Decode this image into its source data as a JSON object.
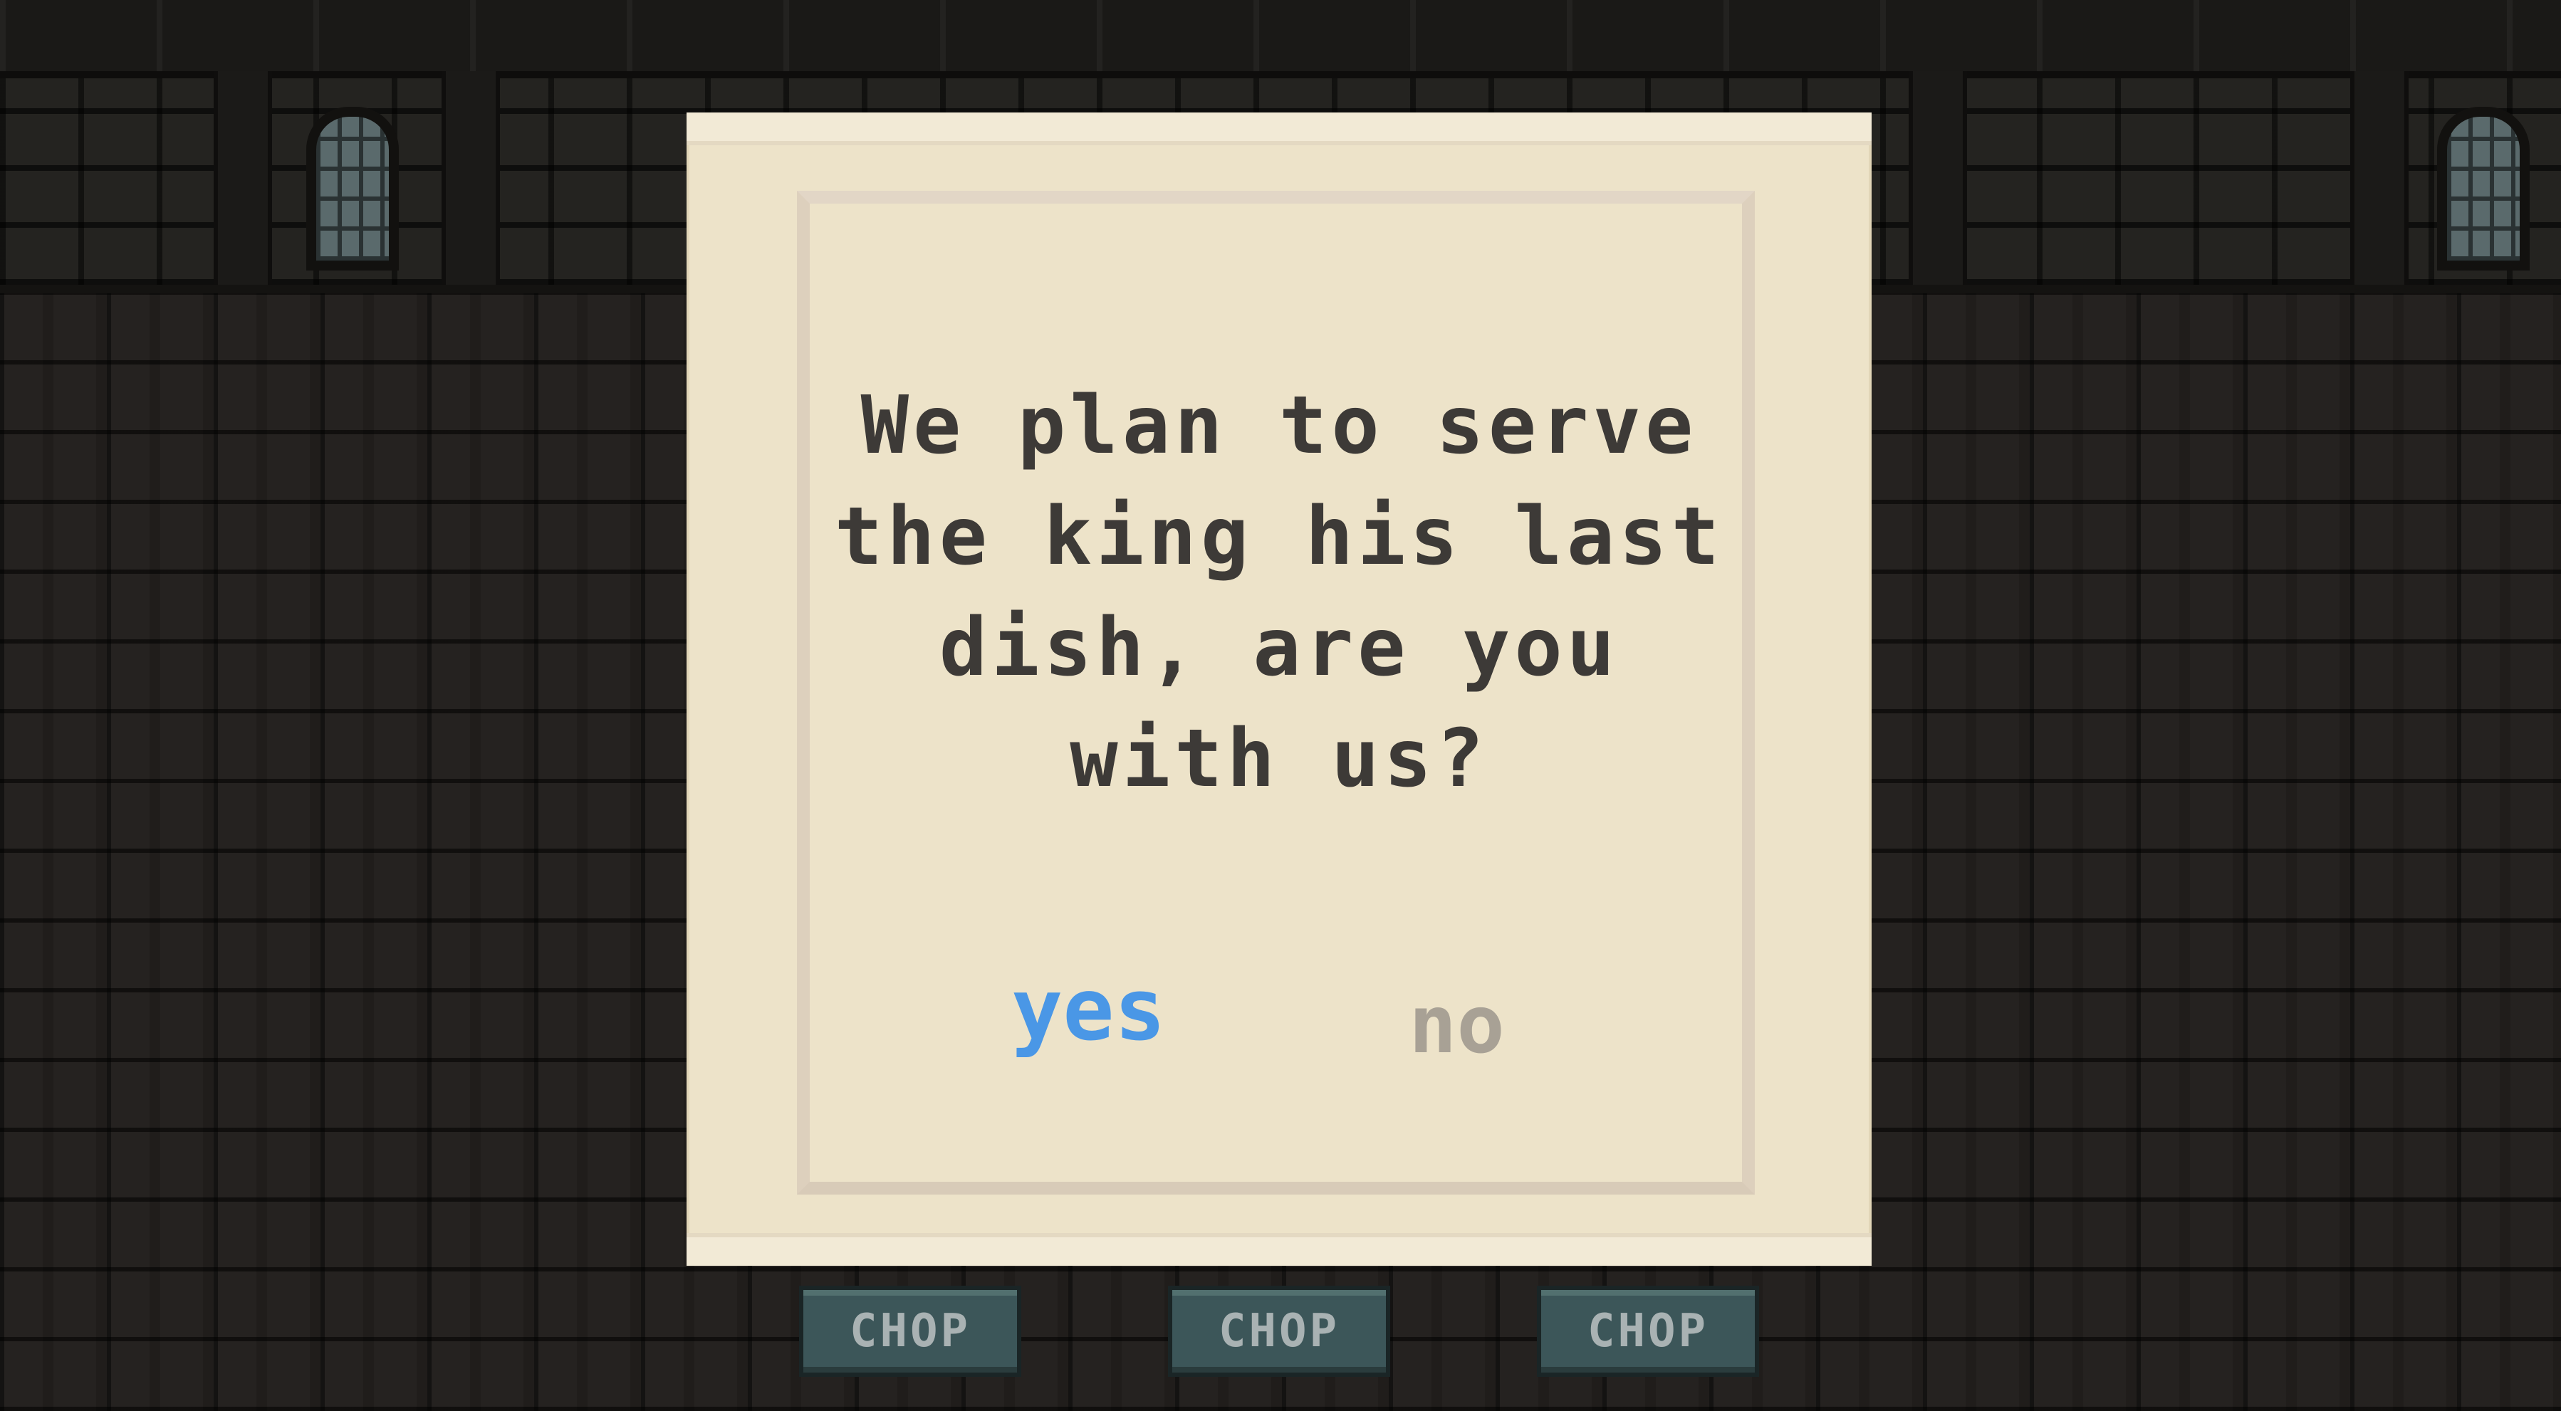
{
  "dialog": {
    "message_lines": [
      "We plan to serve",
      "the king his last",
      "dish, are you",
      "with us?"
    ],
    "yes_label": "yes",
    "no_label": "no"
  },
  "action_bar": {
    "buttons": [
      {
        "label": "CHOP"
      },
      {
        "label": "CHOP"
      },
      {
        "label": "CHOP"
      }
    ]
  },
  "colors": {
    "selected_choice": "#4a97e6",
    "unselected_choice": "#a8a195",
    "message_text": "#3d3a37",
    "parchment": "#ede3c9",
    "button_face": "#3c5659"
  }
}
